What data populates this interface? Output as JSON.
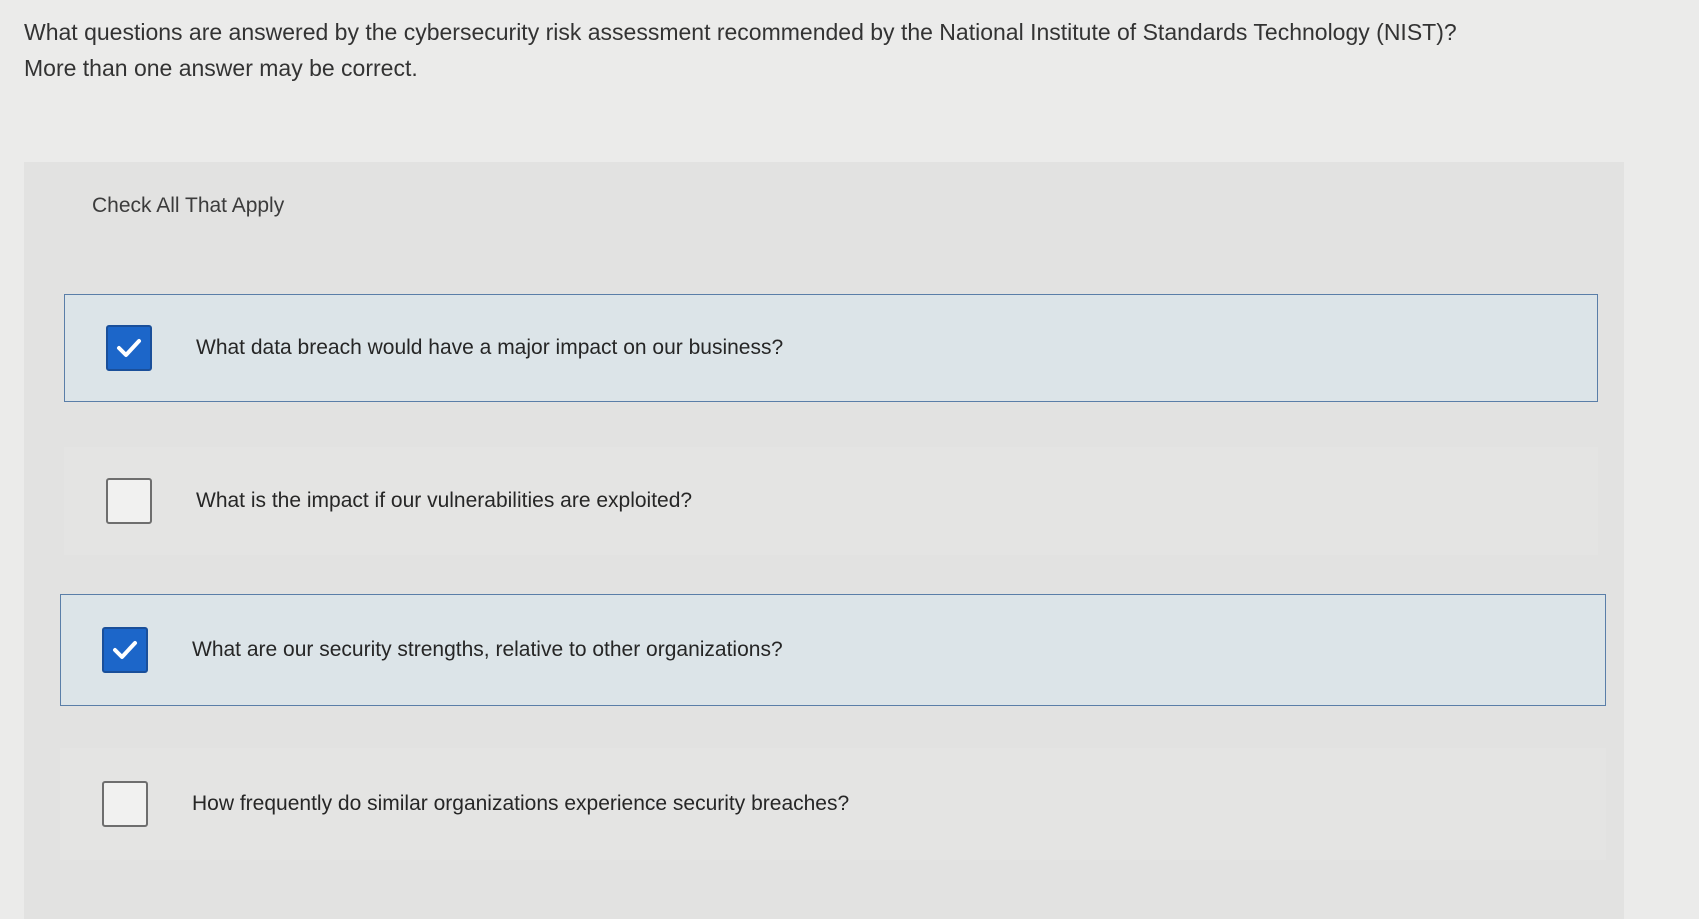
{
  "question": {
    "line1": "What questions are answered by the cybersecurity risk assessment recommended by the National Institute of Standards Technology (NIST)?",
    "line2": "More than one answer may be correct."
  },
  "instruction": "Check All That Apply",
  "options": [
    {
      "label": "What data breach would have a major impact on our business?",
      "checked": true
    },
    {
      "label": "What is the impact if our vulnerabilities are exploited?",
      "checked": false
    },
    {
      "label": "What are our security strengths, relative to other organizations?",
      "checked": true
    },
    {
      "label": "How frequently do similar organizations experience security breaches?",
      "checked": false
    }
  ],
  "colors": {
    "selected_border": "#5a7ea8",
    "selected_fill": "#dce4e8",
    "checkbox_checked": "#1c66c9"
  }
}
